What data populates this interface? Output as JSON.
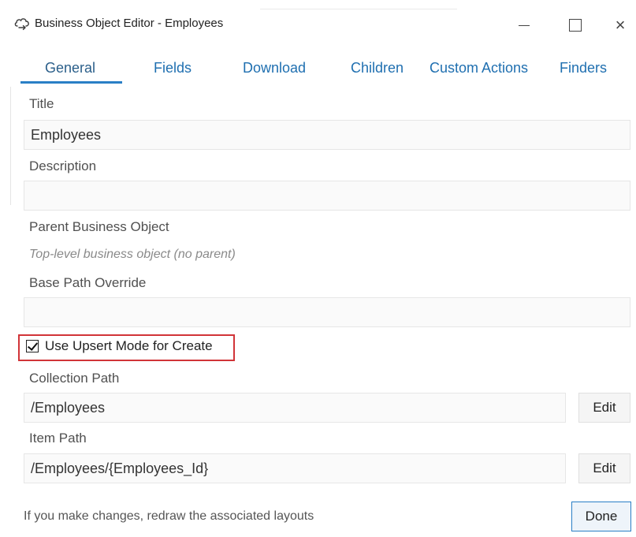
{
  "window": {
    "title": "Business Object Editor - Employees",
    "icon": "cloud-link-icon",
    "controls": {
      "minimize": "minimize-icon",
      "maximize": "maximize-icon",
      "close": "×"
    }
  },
  "tabs": [
    {
      "label": "General",
      "active": true
    },
    {
      "label": "Fields",
      "active": false
    },
    {
      "label": "Download",
      "active": false
    },
    {
      "label": "Children",
      "active": false
    },
    {
      "label": "Custom Actions",
      "active": false
    },
    {
      "label": "Finders",
      "active": false
    }
  ],
  "form": {
    "title_label": "Title",
    "title_value": "Employees",
    "description_label": "Description",
    "description_value": "",
    "parent_label": "Parent Business Object",
    "parent_value": "Top-level business object (no parent)",
    "base_path_label": "Base Path Override",
    "base_path_value": "",
    "upsert_label": "Use Upsert Mode for Create",
    "upsert_checked": true,
    "collection_path_label": "Collection Path",
    "collection_path_value": "/Employees",
    "item_path_label": "Item Path",
    "item_path_value": "/Employees/{Employees_Id}",
    "edit_label": "Edit"
  },
  "footer": {
    "message": "If you make changes, redraw the associated layouts",
    "done_label": "Done"
  },
  "colors": {
    "accent": "#2a7fc6",
    "tab_text": "#1f6fb0",
    "highlight": "#d13438"
  }
}
